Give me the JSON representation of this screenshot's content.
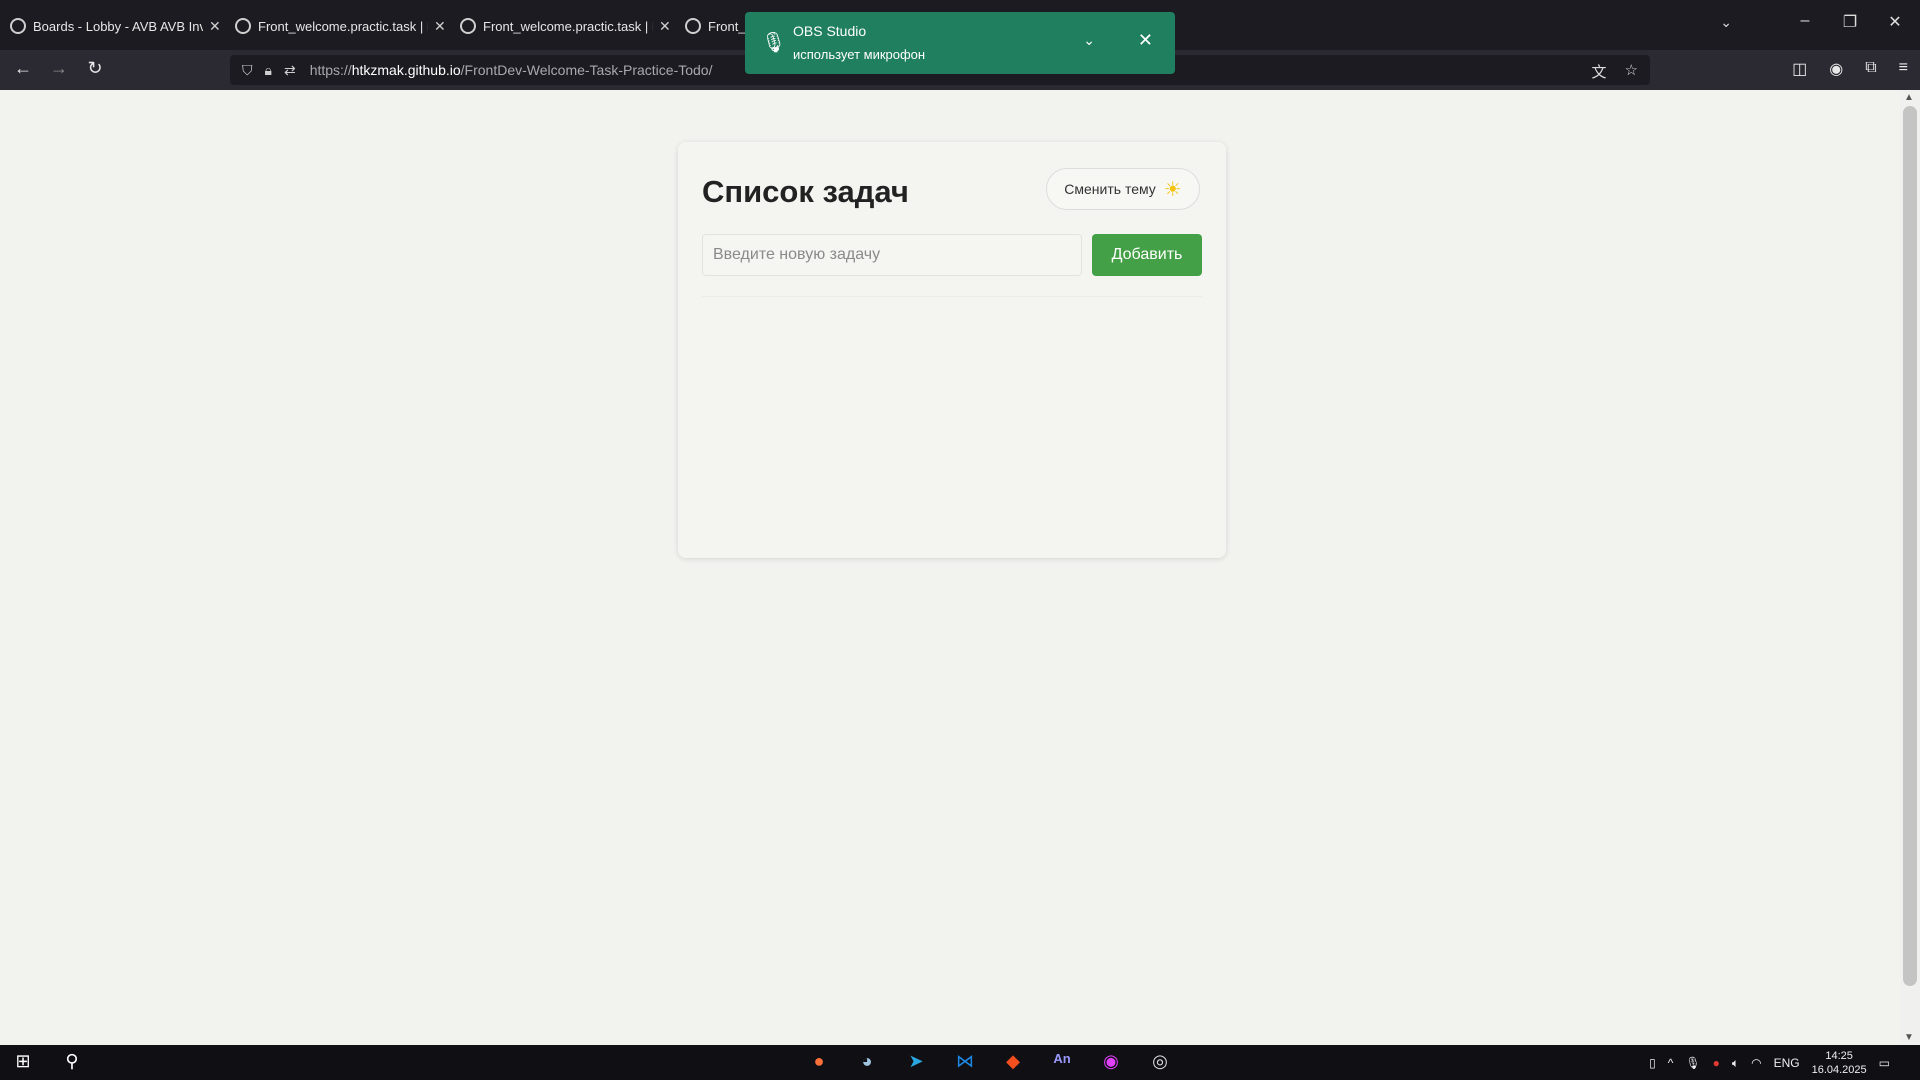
{
  "browser": {
    "tabs": [
      {
        "label": "Boards - Lobby - AVB AVB Inve"
      },
      {
        "label": "Front_welcome.practic.task | Ви"
      },
      {
        "label": "Front_welcome.practic.task | Ви"
      },
      {
        "label": "Front_v"
      }
    ],
    "url_prefix": "https://",
    "url_host": "htkzmak.github.io",
    "url_path": "/FrontDev-Welcome-Task-Practice-Todo/"
  },
  "notification": {
    "title": "OBS Studio",
    "subtitle": "использует микрофон"
  },
  "todo": {
    "title": "Список задач",
    "theme_button_label": "Сменить тему",
    "input_placeholder": "Введите новую задачу",
    "input_value": "",
    "add_button_label": "Добавить",
    "tasks": []
  },
  "taskbar": {
    "language": "ENG",
    "time": "14:25",
    "date": "16.04.2025"
  },
  "colors": {
    "accent_green": "#43a047",
    "notification_bg": "#1f7f5f",
    "sun": "#f4c20d"
  },
  "icons": [
    "firefox-icon",
    "steam-icon",
    "telegram-icon",
    "vscode-icon",
    "figma-icon",
    "animate-icon",
    "browser-icon",
    "obs-icon"
  ]
}
